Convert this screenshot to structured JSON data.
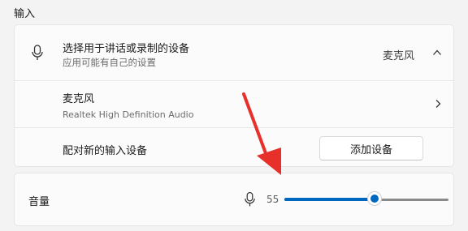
{
  "section_title": "输入",
  "input_group": {
    "header": {
      "title": "选择用于讲话或录制的设备",
      "subtitle": "应用可能有自己的设置",
      "selected_device": "麦克风",
      "icon": "microphone-icon",
      "expander_icon": "chevron-up-icon"
    },
    "device": {
      "name": "麦克风",
      "description": "Realtek High Definition Audio",
      "icon": "chevron-right-icon"
    },
    "pair": {
      "label": "配对新的输入设备",
      "button_label": "添加设备"
    }
  },
  "volume": {
    "label": "音量",
    "value": "55",
    "level": 0.55,
    "icon": "microphone-icon"
  },
  "colors": {
    "accent": "#0067c0",
    "annotation_arrow": "#e8302a",
    "background": "#f3f3f3",
    "card": "#fbfbfb"
  }
}
